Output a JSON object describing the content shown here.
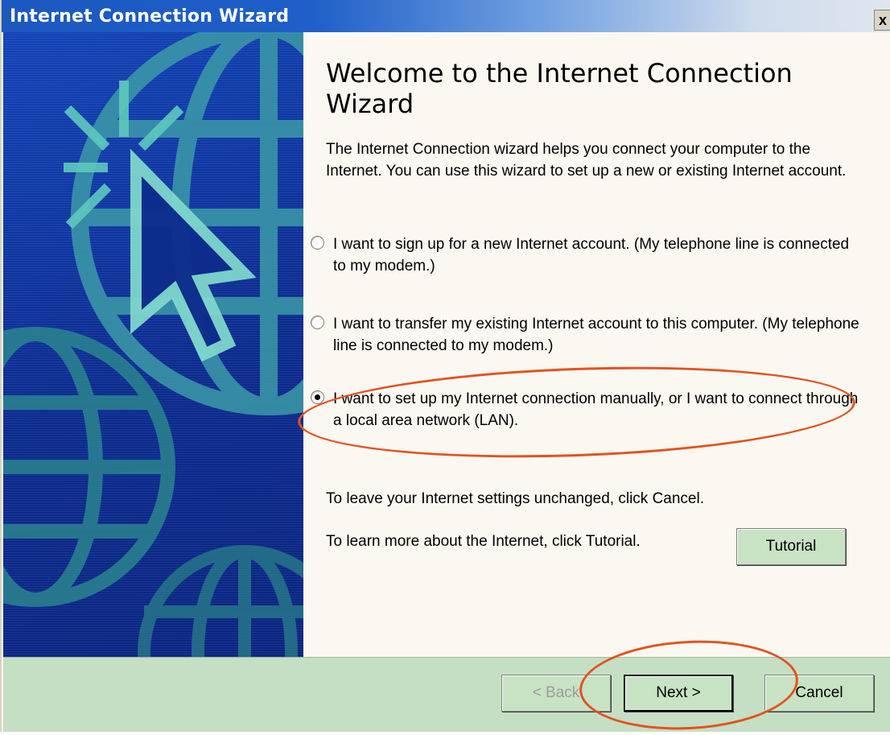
{
  "window": {
    "title": "Internet Connection Wizard",
    "close_label": "x"
  },
  "main": {
    "heading": "Welcome to the Internet Connection Wizard",
    "intro": "The Internet Connection wizard helps you connect your computer to the Internet.  You can use this wizard to set up a new or existing Internet account.",
    "options": [
      {
        "label": "I want to sign up for a new Internet account. (My telephone line is connected to my modem.)",
        "checked": false
      },
      {
        "label": "I want to transfer my existing Internet account to this computer. (My telephone line is connected to my modem.)",
        "checked": false
      },
      {
        "label": "I want to set up my Internet connection manually, or I want to connect through a local area network (LAN).",
        "checked": true
      }
    ],
    "cancel_hint": "To leave your Internet settings unchanged, click Cancel.",
    "tutorial_hint": "To learn more about the Internet, click Tutorial.",
    "tutorial_button": "Tutorial"
  },
  "footer": {
    "back_label": "< Back",
    "next_label": "Next >",
    "cancel_label": "Cancel"
  },
  "colors": {
    "titlebar": "#1b58c0",
    "banner": "#0e2f94",
    "button_face": "#c8e2c4",
    "annotation": "#e2531f"
  }
}
